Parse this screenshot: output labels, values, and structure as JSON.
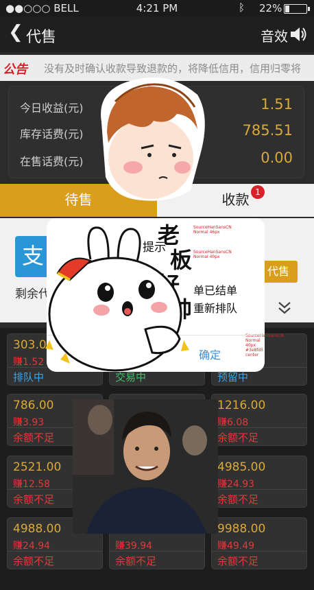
{
  "status_bar": {
    "carrier": "●●○○○ BELL",
    "time": "4:21 PM",
    "battery": "22%",
    "battery_level": 0.22
  },
  "nav": {
    "back_glyph": "❮",
    "title": "代售",
    "sound_label": "音效"
  },
  "notice": {
    "tag": "公告",
    "text": "没有及时确认收款导致退款的，将降低信用，信用归零将"
  },
  "stats": [
    {
      "label": "今日收益(元)",
      "value": "1.51"
    },
    {
      "label": "库存话费(元)",
      "value": "785.51"
    },
    {
      "label": "在售话费(元)",
      "value": "0.00"
    }
  ],
  "tabs": [
    {
      "label": "待售"
    },
    {
      "label": "收款",
      "badge": "1"
    }
  ],
  "info": {
    "logo_glyph": "支",
    "agent_button": "代售",
    "remaining": "剩余代"
  },
  "orders": [
    {
      "amount": "303.00",
      "earn": "赚1.52",
      "state": "排队中",
      "state_color": "#3ba3e8"
    },
    {
      "amount": "",
      "earn": "",
      "state": "交易中",
      "state_color": "#43c06a"
    },
    {
      "amount": "",
      "earn": "",
      "state": "预留中",
      "state_color": "#3ba3e8"
    },
    {
      "amount": "786.00",
      "earn": "赚3.93",
      "state": "余额不足",
      "state_color": "#e03a3a"
    },
    {
      "amount": "",
      "earn": "",
      "state": "",
      "state_color": "#e03a3a"
    },
    {
      "amount": "1216.00",
      "earn": "赚6.08",
      "state": "余额不足",
      "state_color": "#e03a3a"
    },
    {
      "amount": "2521.00",
      "earn": "赚12.58",
      "state": "余额不足",
      "state_color": "#e03a3a"
    },
    {
      "amount": "",
      "earn": "",
      "state": "",
      "state_color": "#e03a3a"
    },
    {
      "amount": "4985.00",
      "earn": "赚24.93",
      "state": "余额不足",
      "state_color": "#e03a3a"
    },
    {
      "amount": "4988.00",
      "earn": "赚24.94",
      "state": "余额不足",
      "state_color": "#e03a3a"
    },
    {
      "amount": "4988.00",
      "earn": "赚39.94",
      "state": "余额不足",
      "state_color": "#e03a3a"
    },
    {
      "amount": "9988.00",
      "earn": "赚49.49",
      "state": "余额不足",
      "state_color": "#e03a3a"
    }
  ],
  "dialog": {
    "title": "提示",
    "line1": "单已结单",
    "line2": "重新排队",
    "ok": "确定",
    "annotations": [
      "SourceHanSansCN Normal 46px",
      "SourceHanSansCN Normal 40px",
      "SourceHanSansCN Normal 40px #3e8fd5 center"
    ]
  },
  "sticker_text": "老板好帅",
  "colors": {
    "accent": "#d99e1a",
    "gold": "#d9a93b",
    "red": "#e03a3a",
    "blue": "#3a8fd5"
  }
}
